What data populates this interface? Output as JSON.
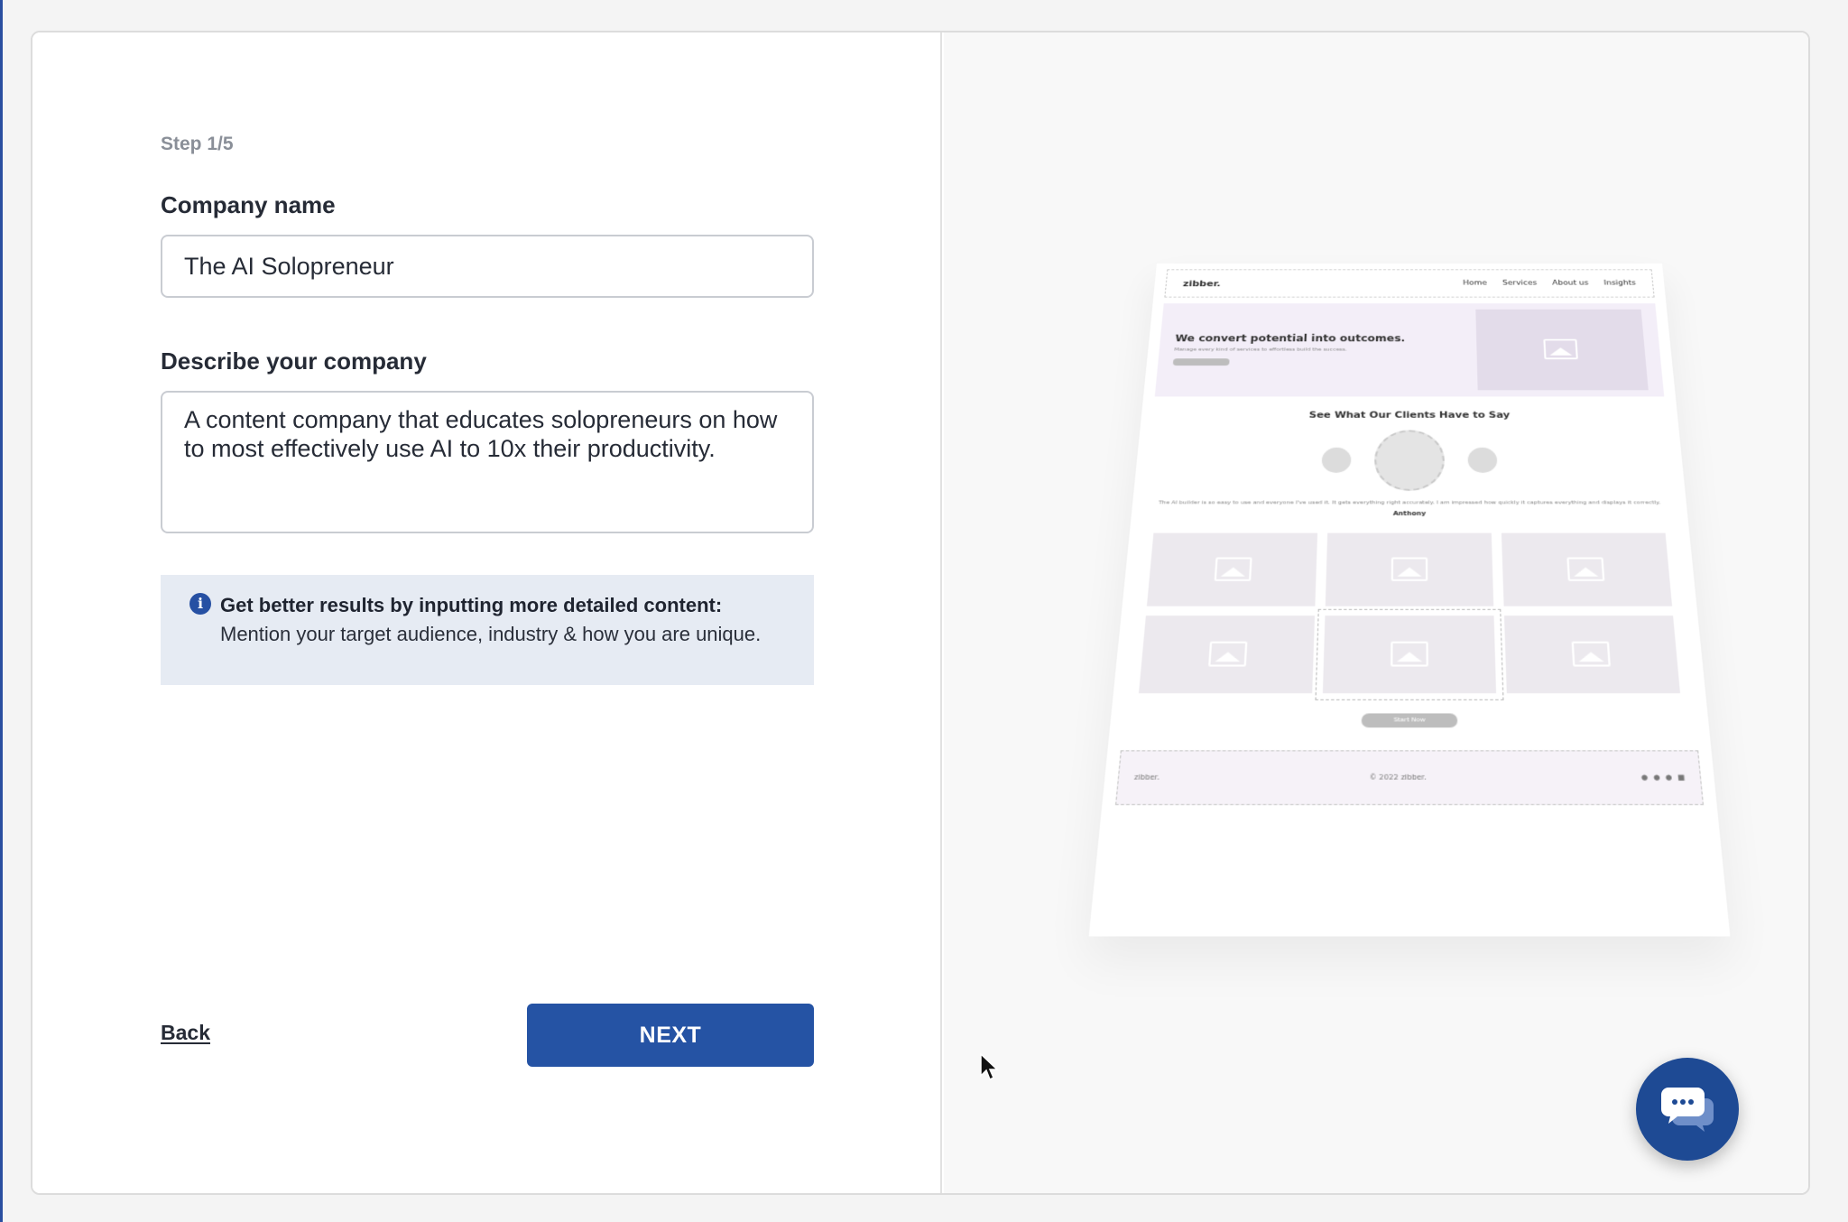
{
  "form": {
    "step": "Step 1/5",
    "company_label": "Company name",
    "company_value": "The AI Solopreneur",
    "describe_label": "Describe your company",
    "describe_value": "A content company that educates solopreneurs on how to most effectively use AI to 10x their productivity.",
    "tip_title": "Get better results by inputting more detailed content:",
    "tip_body": "Mention your target audience, industry & how you are unique.",
    "back_label": "Back",
    "next_label": "NEXT"
  },
  "preview": {
    "logo": "zibber.",
    "nav_links": [
      "Home",
      "Services",
      "About us",
      "Insights"
    ],
    "hero_title": "We convert potential into outcomes.",
    "hero_sub": "Manage every kind of services to effortless build the success.",
    "hero_button": "Start Now",
    "testimonials_title": "See What Our Clients Have to Say",
    "quote": "The AI builder is so easy to use and everyone I've used it. It gets everything right accurately. I am impressed how quickly it captures everything and displays it correctly.",
    "author": "Anthony",
    "start_button": "Start Now",
    "footer_logo": "zibber.",
    "footer_copy": "© 2022 zibber."
  },
  "icons": {
    "info": "info-icon",
    "chat": "chat-bubble-icon",
    "cursor": "mouse-pointer-icon"
  },
  "colors": {
    "primary": "#2553a4",
    "tip_background": "#e6ebf3",
    "chat_button": "#1e4a94"
  }
}
